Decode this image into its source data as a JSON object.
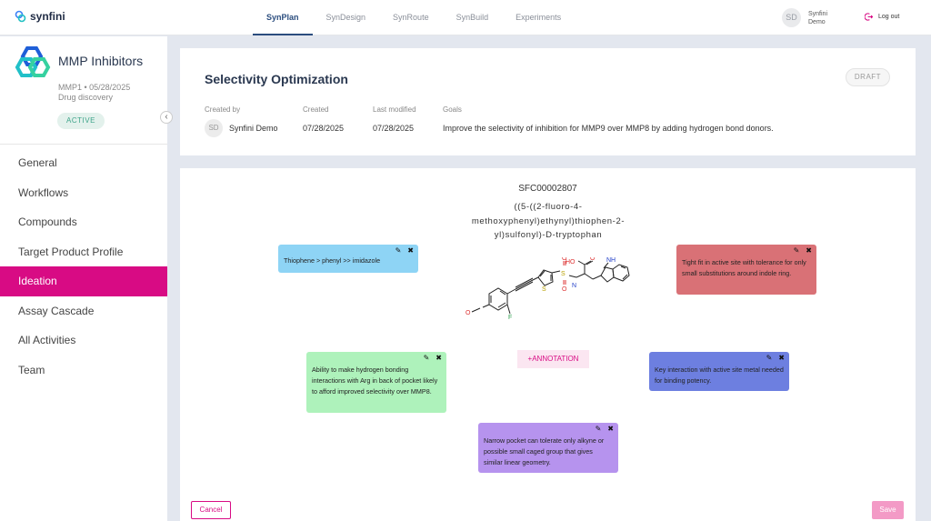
{
  "app": {
    "brand": "synfini"
  },
  "nav_tabs": [
    {
      "label": "SynPlan",
      "active": true
    },
    {
      "label": "SynDesign"
    },
    {
      "label": "SynRoute"
    },
    {
      "label": "SynBuild"
    },
    {
      "label": "Experiments"
    }
  ],
  "user": {
    "initials": "SD",
    "name_line1": "Synfini",
    "name_line2": "Demo",
    "logout_label": "Log out"
  },
  "project": {
    "title": "MMP Inhibitors",
    "meta_line1": "MMP1 • 05/28/2025",
    "meta_line2": "Drug discovery",
    "status": "ACTIVE",
    "collapse_glyph": "‹"
  },
  "sidebar": {
    "items": [
      {
        "label": "General"
      },
      {
        "label": "Workflows"
      },
      {
        "label": "Compounds"
      },
      {
        "label": "Target Product Profile"
      },
      {
        "label": "Ideation",
        "active": true
      },
      {
        "label": "Assay Cascade"
      },
      {
        "label": "All Activities"
      },
      {
        "label": "Team"
      }
    ]
  },
  "header": {
    "title": "Selectivity Optimization",
    "status": "DRAFT",
    "created_by_label": "Created by",
    "created_by_initials": "SD",
    "created_by": "Synfini Demo",
    "created_label": "Created",
    "created": "07/28/2025",
    "modified_label": "Last modified",
    "modified": "07/28/2025",
    "goals_label": "Goals",
    "goals": "Improve the selectivity of inhibition for MMP9 over MMP8 by adding hydrogen bond donors."
  },
  "compound": {
    "id": "SFC00002807",
    "name_line1": "((5-((2-fluoro-4-",
    "name_line2": "methoxyphenyl)ethynyl)thiophen-2-",
    "name_line3": "yl)sulfonyl)-D-tryptophan",
    "atoms": {
      "o_methoxy": "O",
      "f": "F",
      "s_thio": "S",
      "s_sulfonyl": "S",
      "o_up": "O",
      "o_down": "O",
      "nh": "NH",
      "n_h": "N",
      "ho": "HO",
      "o_acid": "O",
      "n_indole": "NH"
    }
  },
  "annotations": {
    "add_label": "+ANNOTATION",
    "edit_icon": "✎",
    "close_icon": "✖",
    "blue": "Thiophene > phenyl >> imidazole",
    "red": "Tight fit in active site with tolerance for only small substitutions around indole ring.",
    "green": "Ability to make hydrogen bonding interactions with Arg in back of pocket likely to afford improved selectivity over MMP8.",
    "indigo": "Key interaction with active site metal needed for binding potency.",
    "purple": "Narrow pocket can tolerate only alkyne or possible small caged group that gives similar linear geometry.",
    "colors": {
      "blue": "#8ed4f5",
      "red": "#d97176",
      "green": "#aef2bb",
      "indigo": "#6d7fe0",
      "purple": "#b693ee"
    }
  },
  "actions": {
    "cancel": "Cancel",
    "save": "Save"
  },
  "colors": {
    "accent": "#d80b84",
    "nav_active": "#2b4d7e",
    "badge_active": "#3ea48a"
  }
}
